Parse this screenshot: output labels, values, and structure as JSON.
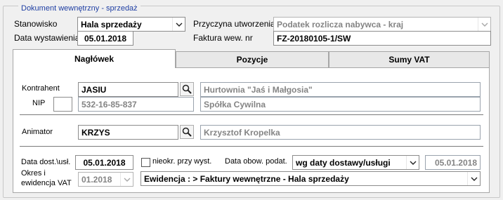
{
  "window": {
    "title": "Dokument wewnętrzny - sprzedaż"
  },
  "header": {
    "stanowisko_label": "Stanowisko",
    "stanowisko_value": "Hala sprzedaży",
    "przyczyna_label": "Przyczyna utworzenia",
    "przyczyna_value": "Podatek rozlicza nabywca - kraj",
    "data_wystawienia_label": "Data wystawienia",
    "data_wystawienia_value": "05.01.2018",
    "faktura_label": "Faktura wew. nr",
    "faktura_value": "FZ-20180105-1/SW"
  },
  "tabs": [
    {
      "label": "Nagłówek",
      "active": true
    },
    {
      "label": "Pozycje",
      "active": false
    },
    {
      "label": "Sumy VAT",
      "active": false
    }
  ],
  "kontrahent": {
    "label": "Kontrahent",
    "code": "JASIU",
    "name": "Hurtownia \"Jaś i Małgosia\"",
    "nip_label": "NIP",
    "nip_prefix": "",
    "nip_value": "532-16-85-837",
    "form": "Spółka Cywilna"
  },
  "animator": {
    "label": "Animator",
    "code": "KRZYS",
    "name": "Krzysztof Kropelka"
  },
  "dates": {
    "dost_label": "Data dost.\\usł.",
    "dost_value": "05.01.2018",
    "nieokr_label": "nieokr. przy wyst.",
    "obow_label": "Data obow. podat.",
    "obow_mode": "wg daty dostawy/usługi",
    "obow_value": "05.01.2018",
    "okres_label_line1": "Okres  i",
    "okres_label_line2": "ewidencja VAT",
    "okres_value": "01.2018",
    "ewidencja_value": "Ewidencja : > Faktury wewnętrzne - Hala sprzedaży"
  },
  "icons": {
    "search": "magnifier-icon",
    "dropdown": "chevron-down-icon"
  },
  "colors": {
    "legend_text": "#1f3fa3",
    "readonly_text": "#848484"
  }
}
